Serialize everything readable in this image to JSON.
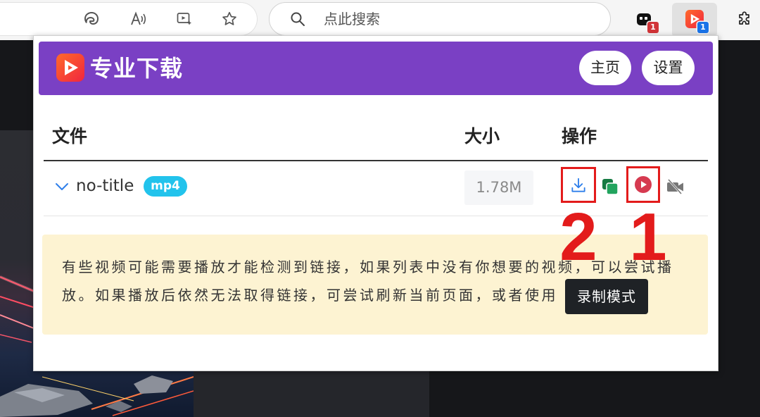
{
  "toolbar": {
    "address_bar_icons": [
      "edge-icon",
      "read-aloud-icon",
      "immersive-reader-icon",
      "favorite-star-icon"
    ],
    "search": {
      "placeholder": "点此搜索",
      "icon": "search-icon"
    },
    "extensions": [
      {
        "icon": "extension-icon",
        "badge": "1",
        "badge_color": "#d13438"
      },
      {
        "icon": "video-downloader-icon",
        "badge": "1",
        "badge_color": "#1a73e8",
        "active": true
      },
      {
        "icon": "puzzle-icon"
      }
    ]
  },
  "popup": {
    "title": "专业下载",
    "colors": {
      "header": "#7a40c4",
      "accent": "#2f7fea",
      "format_badge": "#22c3ec",
      "notice_bg": "#fdf3d2",
      "record_button": "#1f2226"
    },
    "header_buttons": {
      "home": "主页",
      "settings": "设置"
    },
    "table": {
      "columns": [
        "文件",
        "大小",
        "操作"
      ],
      "rows": [
        {
          "name": "no-title",
          "format": "mp4",
          "size": "1.78M",
          "actions": [
            "download-icon",
            "copy-icon",
            "play-icon",
            "camera-off-icon"
          ]
        }
      ]
    },
    "notice": {
      "text": "有些视频可能需要播放才能检测到链接，如果列表中没有你想要的视频，可以尝试播放。如果播放后依然无法取得链接，可尝试刷新当前页面，或者使用",
      "button": "录制模式"
    }
  },
  "annotations": {
    "color": "#e31b1b",
    "labels": [
      "2",
      "1"
    ]
  }
}
